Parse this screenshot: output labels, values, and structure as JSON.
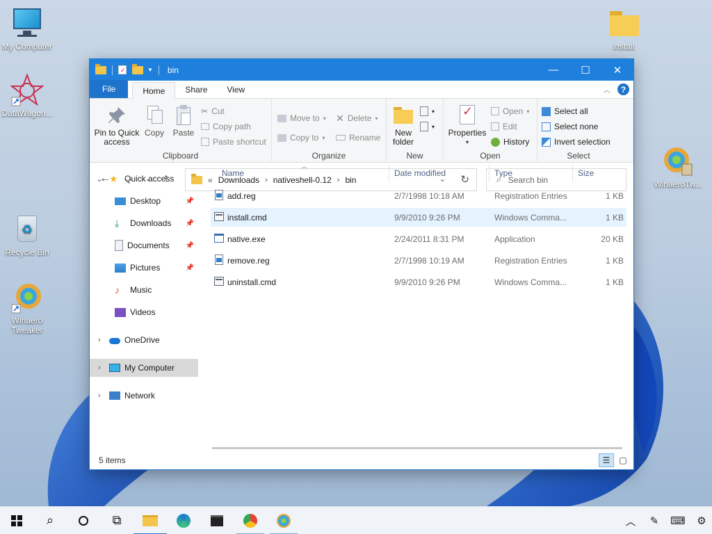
{
  "desktop": {
    "icons": [
      {
        "label": "My Computer",
        "icon": "monitor-icon"
      },
      {
        "label": "DataWagon...",
        "icon": "datawagon-icon"
      },
      {
        "label": "Recycle Bin",
        "icon": "recycle-bin-icon"
      },
      {
        "label": "Winaero Tweaker",
        "icon": "winaero-tweaker-icon"
      },
      {
        "label": "install",
        "icon": "folder-icon"
      },
      {
        "label": "WinaeroTw...",
        "icon": "winaero-tweaker-setup-icon"
      }
    ]
  },
  "window": {
    "title": "bin",
    "controls": {
      "minimize": "—",
      "maximize": "☐",
      "close": "✕"
    }
  },
  "tabs": {
    "file": "File",
    "home": "Home",
    "share": "Share",
    "view": "View"
  },
  "ribbon": {
    "clipboard": {
      "pin": "Pin to Quick access",
      "copy": "Copy",
      "paste": "Paste",
      "cut": "Cut",
      "copy_path": "Copy path",
      "paste_shortcut": "Paste shortcut",
      "group": "Clipboard"
    },
    "organize": {
      "move_to": "Move to",
      "copy_to": "Copy to",
      "delete": "Delete",
      "rename": "Rename",
      "group": "Organize"
    },
    "new": {
      "new_folder": "New folder",
      "group": "New"
    },
    "open": {
      "properties": "Properties",
      "open": "Open",
      "edit": "Edit",
      "history": "History",
      "group": "Open"
    },
    "select": {
      "select_all": "Select all",
      "select_none": "Select none",
      "invert": "Invert selection",
      "group": "Select"
    }
  },
  "address": {
    "overflow": "«",
    "crumbs": [
      "Downloads",
      "nativeshell-0.12",
      "bin"
    ],
    "search_placeholder": "Search bin"
  },
  "navpane": {
    "quick_access": "Quick access",
    "items": [
      {
        "label": "Desktop",
        "pinned": true
      },
      {
        "label": "Downloads",
        "pinned": true
      },
      {
        "label": "Documents",
        "pinned": true
      },
      {
        "label": "Pictures",
        "pinned": true
      },
      {
        "label": "Music",
        "pinned": false
      },
      {
        "label": "Videos",
        "pinned": false
      }
    ],
    "onedrive": "OneDrive",
    "my_computer": "My Computer",
    "network": "Network"
  },
  "columns": {
    "name": "Name",
    "date": "Date modified",
    "type": "Type",
    "size": "Size"
  },
  "files": [
    {
      "name": "add.reg",
      "date": "2/7/1998 10:18 AM",
      "type": "Registration Entries",
      "size": "1 KB",
      "icon": "reg-file-icon"
    },
    {
      "name": "install.cmd",
      "date": "9/9/2010 9:26 PM",
      "type": "Windows Comma...",
      "size": "1 KB",
      "icon": "cmd-file-icon"
    },
    {
      "name": "native.exe",
      "date": "2/24/2011 8:31 PM",
      "type": "Application",
      "size": "20 KB",
      "icon": "exe-file-icon"
    },
    {
      "name": "remove.reg",
      "date": "2/7/1998 10:19 AM",
      "type": "Registration Entries",
      "size": "1 KB",
      "icon": "reg-file-icon"
    },
    {
      "name": "uninstall.cmd",
      "date": "9/9/2010 9:26 PM",
      "type": "Windows Comma...",
      "size": "1 KB",
      "icon": "cmd-file-icon"
    }
  ],
  "status": {
    "items": "5 items"
  },
  "colors": {
    "accent": "#1e80dc",
    "hover_row": "#e5f3ff",
    "selected_nav": "#d9d9d9"
  }
}
